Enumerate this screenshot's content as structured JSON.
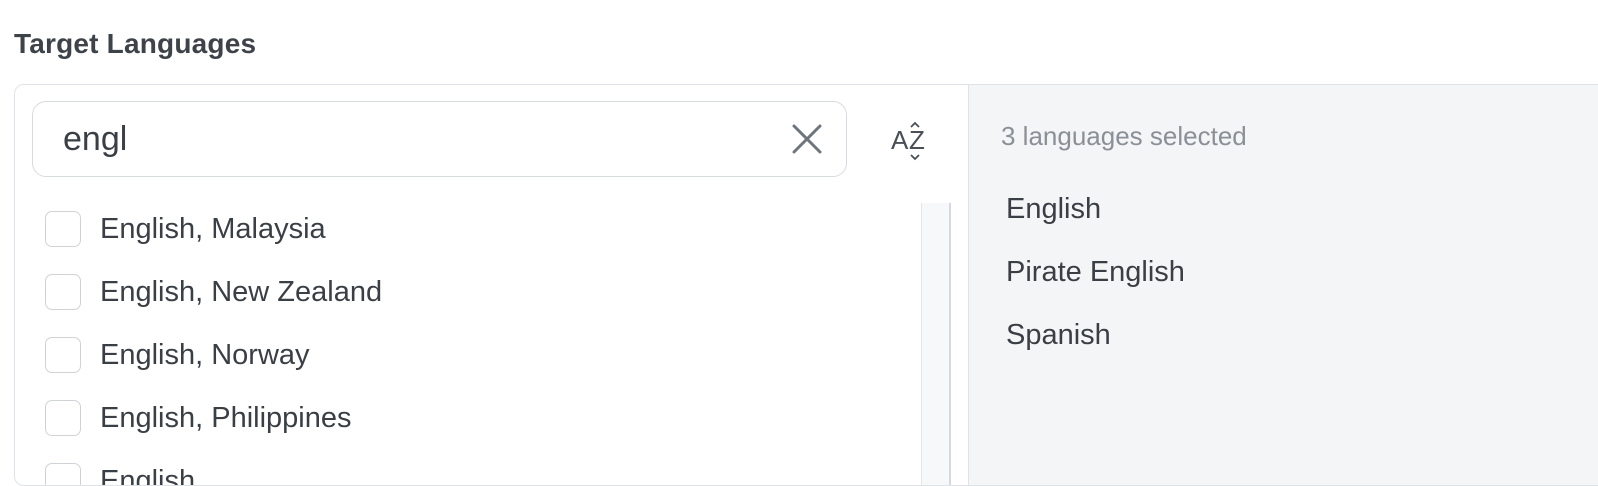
{
  "field": {
    "label": "Target Languages"
  },
  "search": {
    "value": "engl",
    "clear_icon": "close-icon",
    "sort_icon": "sort-alphabetical-icon",
    "sort_label": "AZ"
  },
  "available": {
    "items": [
      {
        "label": "English, Malaysia",
        "checked": false
      },
      {
        "label": "English, New Zealand",
        "checked": false
      },
      {
        "label": "English, Norway",
        "checked": false
      },
      {
        "label": "English, Philippines",
        "checked": false
      },
      {
        "label": "English, …",
        "checked": false
      }
    ]
  },
  "selected": {
    "count_text": "3 languages selected",
    "items": [
      {
        "label": "English"
      },
      {
        "label": "Pirate English"
      },
      {
        "label": "Spanish"
      }
    ]
  },
  "colors": {
    "border": "#dfe2e6",
    "panel_bg": "#f4f5f7",
    "text": "#3a3f45",
    "muted_text": "#8a9097"
  }
}
